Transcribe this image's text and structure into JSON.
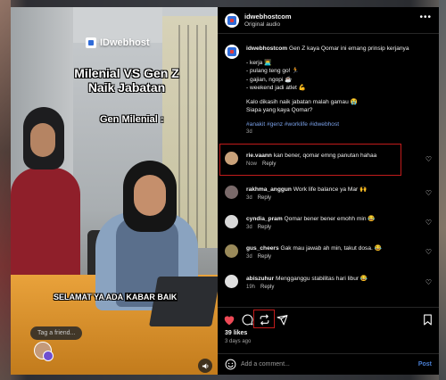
{
  "video": {
    "brand": "IDwebhost",
    "title_line1": "Milenial VS Gen Z",
    "title_line2": "Naik Jabatan",
    "subtitle": "Gen Milenial :",
    "caption_part1": "SELAMAT YA ADA ",
    "caption_part2": "KABAR BAIK",
    "tag_placeholder": "Tag a friend...",
    "mute_icon": "speaker-icon"
  },
  "header": {
    "username": "idwebhostcom",
    "audio": "Original audio",
    "more_icon": "more-icon"
  },
  "post_caption": {
    "username": "idwebhostcom",
    "text": "Gen Z kaya Qomar ini emang prinsip kerjanya",
    "list": [
      "- kerja 👨‍💻",
      "- pulang teng go! 🏃",
      "- gajian, ngopi ☕",
      "- weekend jadi atlet 💪"
    ],
    "question1": "Kalo dikasih naik jabatan malah gamau 😭",
    "question2": "Siapa yang kaya Qomar?",
    "hashtags": "#anakit #genz #worklife #idwebhost",
    "time": "3d"
  },
  "comments": [
    {
      "username": "rie.vaann",
      "text": "kan bener, qomar emng panutan hahaa",
      "time": "Now",
      "reply": "Reply",
      "avatar_color": "#c9a27a"
    },
    {
      "username": "rakhma_anggun",
      "text": "Work life balance ya Mar 🙌",
      "time": "3d",
      "reply": "Reply",
      "avatar_color": "#7a6a6a"
    },
    {
      "username": "cyndia_pram",
      "text": "Qomar bener bener emohh min 😂",
      "time": "3d",
      "reply": "Reply",
      "avatar_color": "#d8d8d8"
    },
    {
      "username": "gus_cheers",
      "text": "Gak mau jawab ah min, takut dosa. 😂",
      "time": "3d",
      "reply": "Reply",
      "avatar_color": "#9a8a5a"
    },
    {
      "username": "abiszuhur",
      "text": "Mengganggu stabilitas hari libur 😂",
      "time": "19h",
      "reply": "Reply",
      "avatar_color": "#e0e0e0"
    }
  ],
  "actions": {
    "likes": "39 likes",
    "ago": "3 days ago",
    "comment_placeholder": "Add a comment...",
    "post_label": "Post",
    "like_color": "#ed4956"
  }
}
